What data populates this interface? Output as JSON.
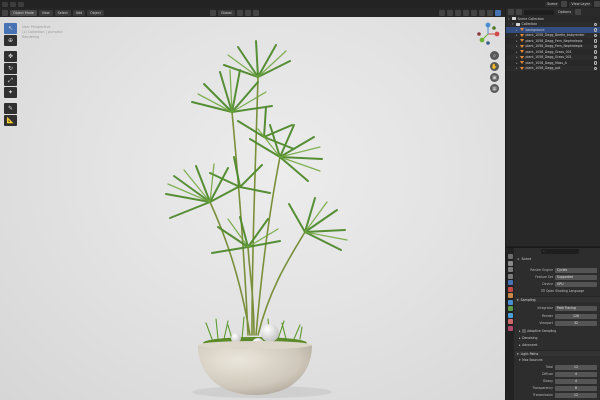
{
  "topbar": {
    "scene_label": "Scene",
    "view_layer_label": "View Layer"
  },
  "viewport_header": {
    "mode": "Object Mode",
    "menus": [
      "View",
      "Select",
      "Add",
      "Object"
    ],
    "orientation": "Global"
  },
  "viewport": {
    "info_lines": [
      "User Perspective",
      "(1) Collection | pumpkin",
      "Rendering"
    ]
  },
  "outliner": {
    "header_label": "Options",
    "rows": [
      {
        "name": "Scene Collection",
        "icon": "scene-icon",
        "indent": 0,
        "selected": false
      },
      {
        "name": "Collection",
        "icon": "collection-icon",
        "indent": 1,
        "selected": false
      },
      {
        "name": "background",
        "icon": "mesh-icon",
        "indent": 2,
        "selected": true
      },
      {
        "name": "plant_1058_Dagg_Beetle_babyrenter",
        "icon": "mesh-icon",
        "indent": 2,
        "selected": false
      },
      {
        "name": "plant_1058_Dagg_Fern_Nephrolepis",
        "icon": "mesh-icon",
        "indent": 2,
        "selected": false
      },
      {
        "name": "plant_1058_Dagg_Fern_Nephrolepis",
        "icon": "mesh-icon",
        "indent": 2,
        "selected": false
      },
      {
        "name": "plant_1058_Dagg_Grass_001",
        "icon": "mesh-icon",
        "indent": 2,
        "selected": false
      },
      {
        "name": "plant_1058_Dagg_Grass_001",
        "icon": "mesh-icon",
        "indent": 2,
        "selected": false
      },
      {
        "name": "plant_1058_Dagg_Moss_A",
        "icon": "mesh-icon",
        "indent": 2,
        "selected": false
      },
      {
        "name": "plant_1058_Dagg_pot",
        "icon": "mesh-icon",
        "indent": 2,
        "selected": false
      }
    ]
  },
  "properties": {
    "context": "Scene",
    "rows": [
      {
        "label": "Render Engine",
        "value": "Cycles"
      },
      {
        "label": "Feature Set",
        "value": "Supported"
      },
      {
        "label": "Device",
        "value": "GPU"
      }
    ],
    "osl_label": "Open Shading Language",
    "sampling_label": "Sampling",
    "integrator": {
      "label": "Integrator",
      "value": "Path Tracing"
    },
    "render_samples": {
      "label": "Render",
      "value": "128"
    },
    "viewport_samples": {
      "label": "Viewport",
      "value": "32"
    },
    "adaptive_sampling_label": "Adaptive Sampling",
    "denoising_label": "Denoising",
    "advanced_label": "Advanced",
    "light_paths_label": "Light Paths",
    "max_bounces_label": "Max Bounces",
    "bounces": [
      {
        "label": "Total",
        "value": "12"
      },
      {
        "label": "Diffuse",
        "value": "4"
      },
      {
        "label": "Glossy",
        "value": "4"
      },
      {
        "label": "Transparency",
        "value": "8"
      },
      {
        "label": "Transmission",
        "value": "12"
      }
    ]
  },
  "colors": {
    "accent": "#4772b3",
    "selection": "#334d80",
    "mesh_icon": "#e28b3a",
    "viewport_bg": "#e6e6e6"
  }
}
